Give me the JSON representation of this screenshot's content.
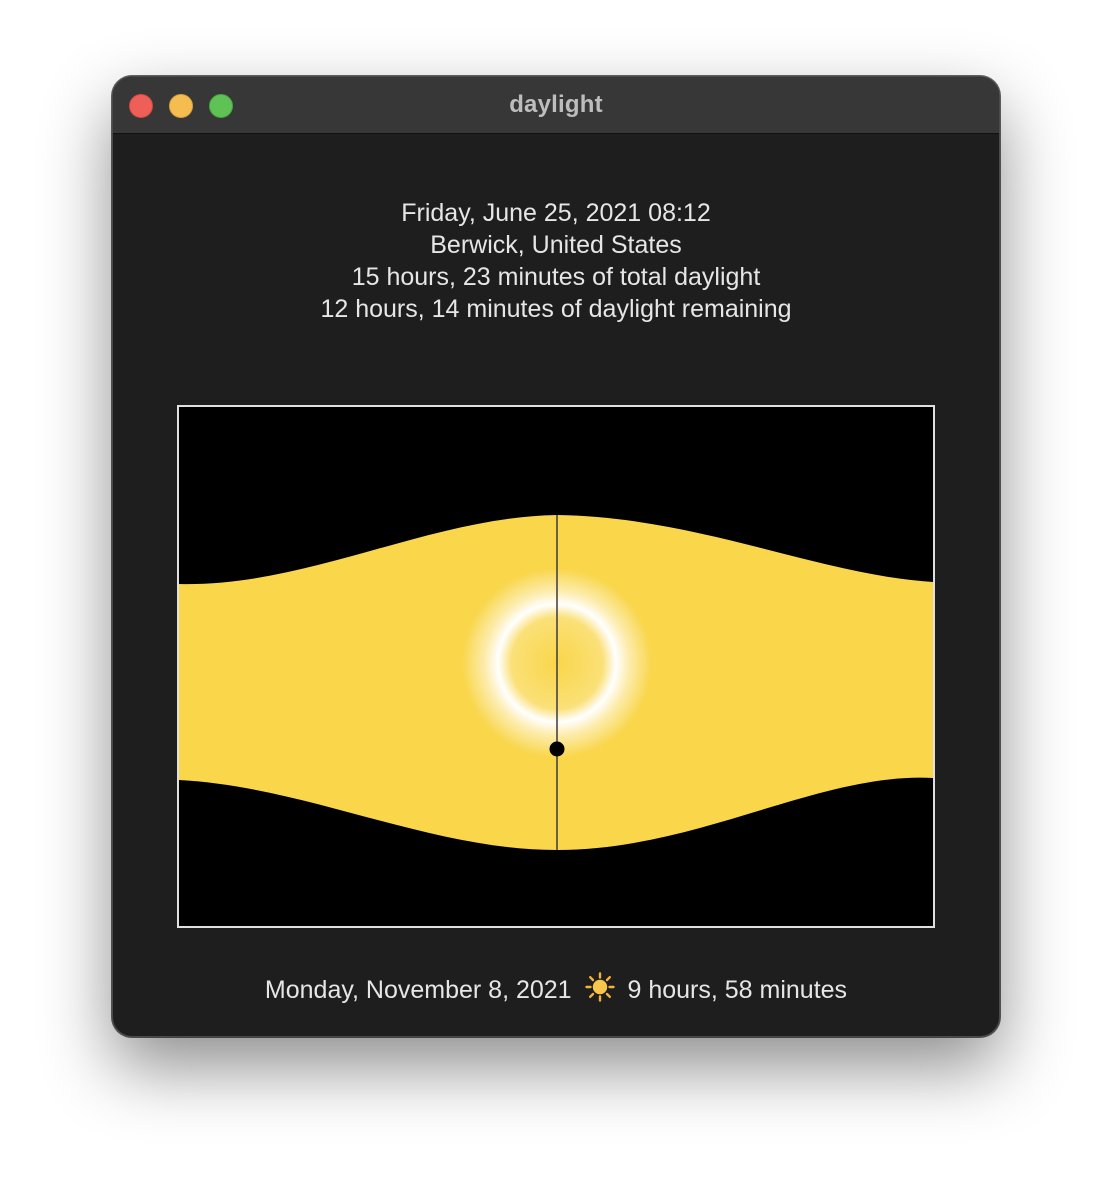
{
  "window": {
    "title": "daylight"
  },
  "info": {
    "datetime": "Friday, June 25, 2021 08:12",
    "location": "Berwick, United States",
    "total_daylight": "15 hours, 23 minutes of total daylight",
    "remaining_daylight": "12 hours, 14 minutes of daylight remaining"
  },
  "chart": {
    "background_color": "#000000",
    "daylight_color": "#f9d64a",
    "border_color": "#e0e0e0"
  },
  "footer": {
    "date": "Monday, November 8, 2021",
    "icon": "sun-icon",
    "duration": "9 hours, 58 minutes"
  }
}
